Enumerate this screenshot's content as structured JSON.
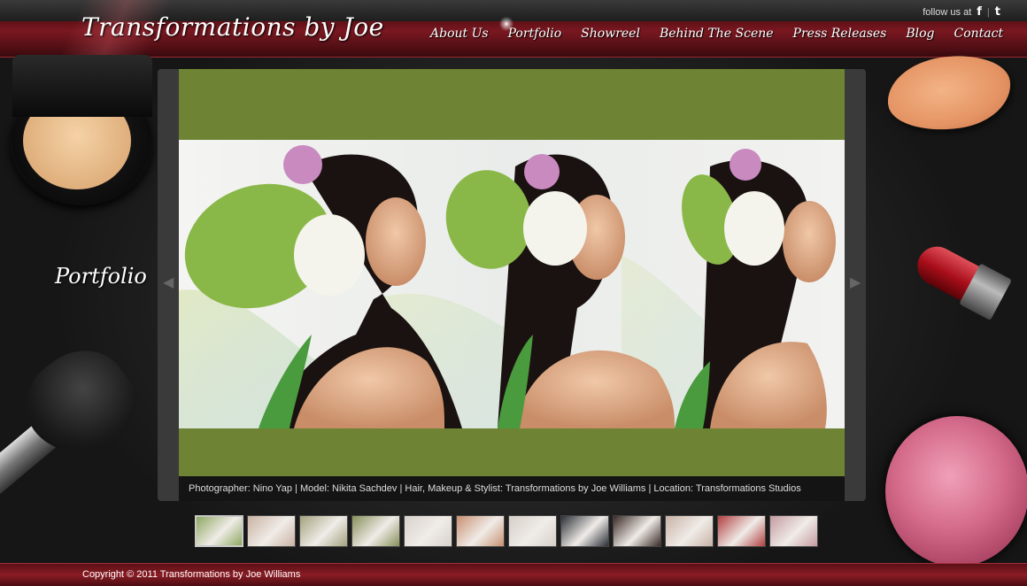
{
  "site": {
    "logo": "Transformations by Joe",
    "follow_label": "follow us at",
    "social": [
      {
        "icon": "facebook-icon",
        "glyph": "f"
      },
      {
        "icon": "twitter-icon",
        "glyph": "t"
      }
    ]
  },
  "nav": {
    "items": [
      {
        "label": "About Us",
        "active": false
      },
      {
        "label": "Portfolio",
        "active": true
      },
      {
        "label": "Showreel",
        "active": false
      },
      {
        "label": "Behind The Scene",
        "active": false
      },
      {
        "label": "Press Releases",
        "active": false
      },
      {
        "label": "Blog",
        "active": false
      },
      {
        "label": "Contact",
        "active": false
      }
    ]
  },
  "page": {
    "section_title": "Portfolio"
  },
  "gallery": {
    "caption": "Photographer: Nino Yap | Model: Nikita Sachdev | Hair, Makeup & Stylist: Transformations by Joe Williams | Location: Transformations Studios",
    "prev_glyph": "◀",
    "next_glyph": "▶",
    "thumbnails": [
      {
        "tone": "#8ea860",
        "active": true
      },
      {
        "tone": "#c9b2a2",
        "active": false
      },
      {
        "tone": "#a3a27e",
        "active": false
      },
      {
        "tone": "#87905a",
        "active": false
      },
      {
        "tone": "#d8d2cc",
        "active": false
      },
      {
        "tone": "#c89070",
        "active": false
      },
      {
        "tone": "#d6cfc8",
        "active": false
      },
      {
        "tone": "#2a2e36",
        "active": false
      },
      {
        "tone": "#3a2a26",
        "active": false
      },
      {
        "tone": "#c8b2a6",
        "active": false
      },
      {
        "tone": "#b04040",
        "active": false
      },
      {
        "tone": "#c49aa0",
        "active": false
      }
    ]
  },
  "footer": {
    "copyright": "Copyright © 2011 Transformations by Joe Williams"
  },
  "colors": {
    "header_red": "#7a1720",
    "photo_green": "#6e8434",
    "caption_bg": "#141414"
  }
}
